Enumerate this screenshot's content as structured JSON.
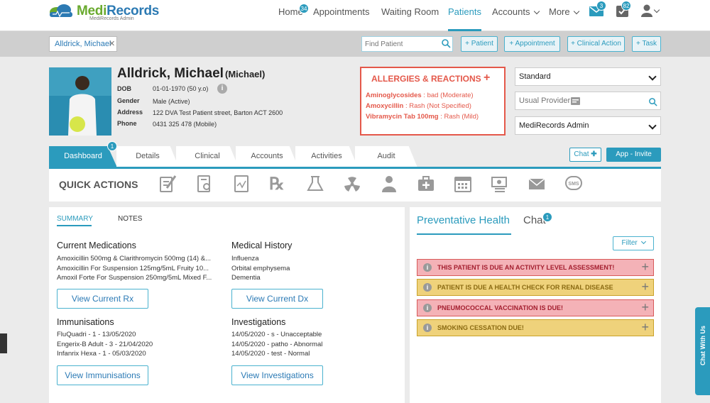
{
  "brand": {
    "name_part1": "Medi",
    "name_part2": "Records",
    "subtitle": "MediRecords Admin",
    "accent": "#2b9bbd"
  },
  "nav": {
    "home": "Home",
    "home_badge": "34",
    "appointments": "Appointments",
    "waiting_room": "Waiting Room",
    "patients": "Patients",
    "accounts": "Accounts",
    "more": "More",
    "mail_badge": "3",
    "tasks_badge": "82"
  },
  "patient_bar": {
    "open_tab": "Alldrick, Michael",
    "find_placeholder": "Find Patient",
    "buttons": [
      "+ Patient",
      "+ Appointment",
      "+ Clinical Action",
      "+ Task"
    ]
  },
  "patient": {
    "name": "Alldrick, Michael",
    "nickname": "(Michael)",
    "fields": [
      {
        "label": "DOB",
        "value": "01-01-1970 (50 y.o)"
      },
      {
        "label": "Gender",
        "value": "Male (Active)"
      },
      {
        "label": "Address",
        "value": "122 DVA Test Patient street, Barton ACT 2600"
      },
      {
        "label": "Phone",
        "value": "0431 325 478 (Mobile)"
      }
    ]
  },
  "allergies": {
    "title": "ALLERGIES & REACTIONS",
    "items": [
      {
        "drug": "Aminoglycosides",
        "reaction": " : bad (Moderate)"
      },
      {
        "drug": "Amoxycillin",
        "reaction": " : Rash (Not Specified)"
      },
      {
        "drug": "Vibramycin Tab 100mg",
        "reaction": " : Rash (Mild)"
      }
    ]
  },
  "right_panel": {
    "billing_type": "Standard",
    "usual_provider_placeholder": "Usual Provider",
    "practitioner": "MediRecords Admin"
  },
  "tabs": [
    {
      "label": "Dashboard",
      "badge": "1"
    },
    {
      "label": "Details"
    },
    {
      "label": "Clinical"
    },
    {
      "label": "Accounts"
    },
    {
      "label": "Activities"
    },
    {
      "label": "Audit"
    }
  ],
  "tab_actions": {
    "chat": "Chat",
    "invite": "App - Invite"
  },
  "quick_actions": {
    "title": "QUICK ACTIONS",
    "icons": [
      "note-icon",
      "referral-icon",
      "document-icon",
      "prescription-icon",
      "pathology-icon",
      "radiology-icon",
      "doctor-icon",
      "medical-kit-icon",
      "calendar-icon",
      "billing-icon",
      "mail-icon",
      "sms-icon"
    ]
  },
  "summary": {
    "tab_summary": "SUMMARY",
    "tab_notes": "NOTES",
    "current_medications": {
      "title": "Current Medications",
      "items": [
        "Amoxicillin 500mg & Clarithromycin 500mg (14) &...",
        "Amoxicillin For Suspension 125mg/5mL Fruity 10...",
        "Amoxil Forte For Suspension 250mg/5mL Mixed F..."
      ],
      "button": "View Current Rx"
    },
    "medical_history": {
      "title": "Medical History",
      "items": [
        "Influenza",
        "Orbital emphysema",
        "Dementia"
      ],
      "button": "View Current Dx"
    },
    "immunisations": {
      "title": "Immunisations",
      "items": [
        "FluQuadri - 1 - 13/05/2020",
        "Engerix-B Adult - 3 - 21/04/2020",
        "Infanrix Hexa - 1 - 05/03/2020"
      ],
      "button": "View Immunisations"
    },
    "investigations": {
      "title": "Investigations",
      "items": [
        "14/05/2020 - s - Unacceptable",
        "14/05/2020 - patho - Abnormal",
        "14/05/2020 - test - Normal"
      ],
      "button": "View Investigations"
    }
  },
  "preventative": {
    "title": "Preventative Health",
    "chat_tab": "Chat",
    "chat_badge": "1",
    "filter": "Filter",
    "alerts": [
      {
        "text": "THIS PATIENT IS DUE AN ACTIVITY LEVEL ASSESSMENT!",
        "level": "red"
      },
      {
        "text": "PATIENT IS DUE A HEALTH CHECK FOR RENAL DISEASE",
        "level": "yellow"
      },
      {
        "text": "PNEUMOCOCCAL VACCINATION IS DUE!",
        "level": "red"
      },
      {
        "text": "SMOKING CESSATION DUE!",
        "level": "yellow"
      }
    ]
  },
  "chat_widget": {
    "label": "Chat With Us"
  }
}
